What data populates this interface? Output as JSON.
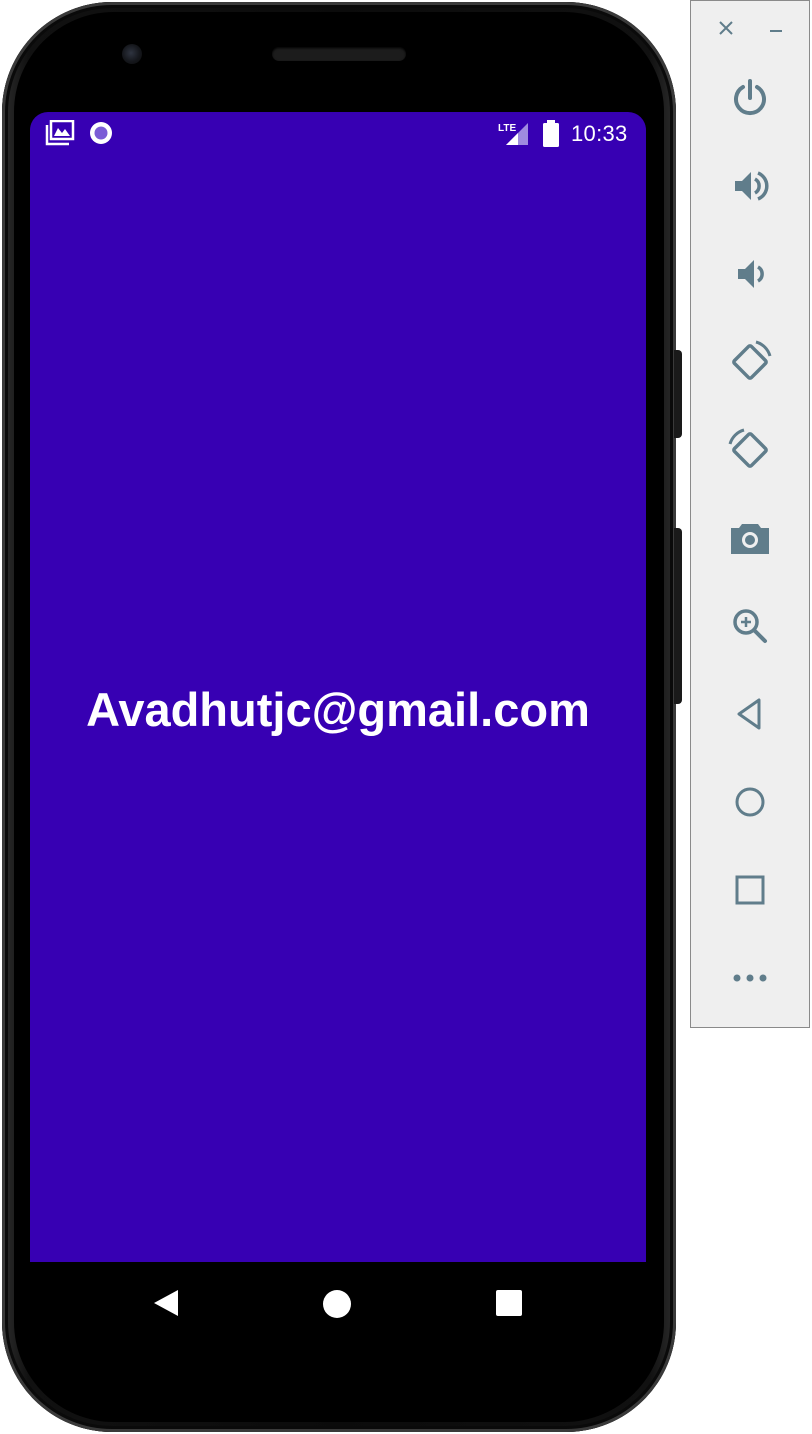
{
  "status_bar": {
    "time": "10:33",
    "network": "LTE",
    "icons": [
      "gallery-icon",
      "record-icon",
      "lte-signal-icon",
      "battery-icon"
    ]
  },
  "screen": {
    "background": "#3700b3",
    "text": "Avadhutjc@gmail.com",
    "text_color": "#ffffff"
  },
  "nav_bar": {
    "buttons": [
      "back-icon",
      "home-icon",
      "recents-icon"
    ]
  },
  "emulator_toolbar": {
    "window_controls": {
      "close_glyph": "×",
      "minimize_glyph": "–"
    },
    "buttons": [
      "power-icon",
      "volume-up-icon",
      "volume-down-icon",
      "rotate-left-icon",
      "rotate-right-icon",
      "camera-icon",
      "zoom-icon",
      "back-icon",
      "home-icon",
      "overview-icon",
      "more-icon"
    ],
    "icon_color": "#607d8b"
  }
}
